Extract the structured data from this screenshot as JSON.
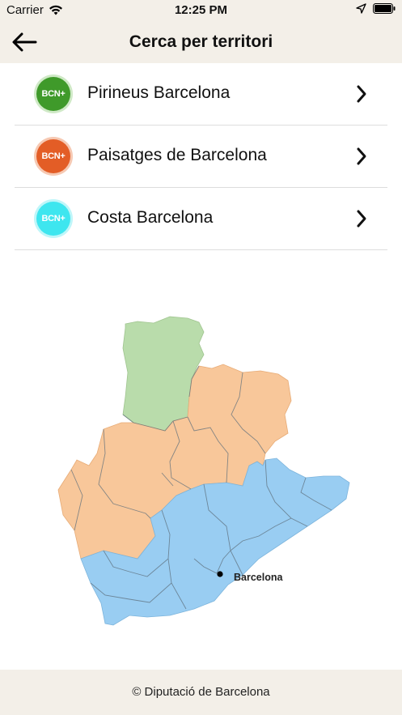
{
  "status_bar": {
    "carrier": "Carrier",
    "time": "12:25 PM"
  },
  "nav": {
    "title": "Cerca per territori",
    "back_icon": "arrow-left-icon"
  },
  "territories": [
    {
      "badge": "BCN+",
      "label": "Pirineus Barcelona",
      "color": "#3f9a2a"
    },
    {
      "badge": "BCN+",
      "label": "Paisatges de Barcelona",
      "color": "#e35d26"
    },
    {
      "badge": "BCN+",
      "label": "Costa Barcelona",
      "color": "#3ee6ef"
    }
  ],
  "map": {
    "city_label": "Barcelona",
    "colors": {
      "pirineus": "#b9dcab",
      "paisatges": "#f8c79a",
      "costa": "#99cdf2"
    }
  },
  "footer": {
    "text": "© Diputació de Barcelona"
  }
}
